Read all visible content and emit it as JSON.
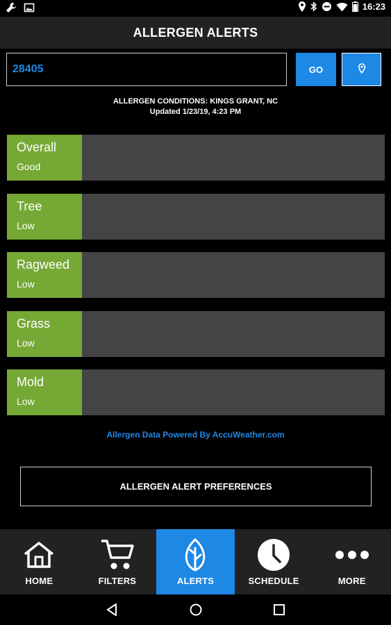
{
  "status_bar": {
    "time": "16:23",
    "left_icons": [
      "wrench-icon",
      "image-icon"
    ],
    "right_icons": [
      "location-icon",
      "bluetooth-icon",
      "do-not-disturb-icon",
      "wifi-icon",
      "battery-icon"
    ]
  },
  "header": {
    "title": "ALLERGEN ALERTS"
  },
  "search": {
    "zip_value": "28405",
    "go_label": "GO",
    "location_icon": "map-pin-icon"
  },
  "conditions": {
    "location_line": "ALLERGEN CONDITIONS: KINGS GRANT, NC",
    "updated_line": "Updated 1/23/19, 4:23 PM"
  },
  "allergens": [
    {
      "name": "Overall",
      "level": "Good"
    },
    {
      "name": "Tree",
      "level": "Low"
    },
    {
      "name": "Ragweed",
      "level": "Low"
    },
    {
      "name": "Grass",
      "level": "Low"
    },
    {
      "name": "Mold",
      "level": "Low"
    }
  ],
  "powered_by": "Allergen Data Powered By AccuWeather.com",
  "preferences_label": "ALLERGEN ALERT PREFERENCES",
  "nav": {
    "items": [
      {
        "label": "HOME",
        "icon": "home-icon"
      },
      {
        "label": "FILTERS",
        "icon": "cart-icon"
      },
      {
        "label": "ALERTS",
        "icon": "leaf-icon",
        "active": true
      },
      {
        "label": "SCHEDULE",
        "icon": "clock-icon"
      },
      {
        "label": "MORE",
        "icon": "more-icon"
      }
    ]
  },
  "colors": {
    "accent": "#1e88e5",
    "tile_green": "#76a836",
    "row_gray": "#444444",
    "header_bg": "#222222"
  }
}
